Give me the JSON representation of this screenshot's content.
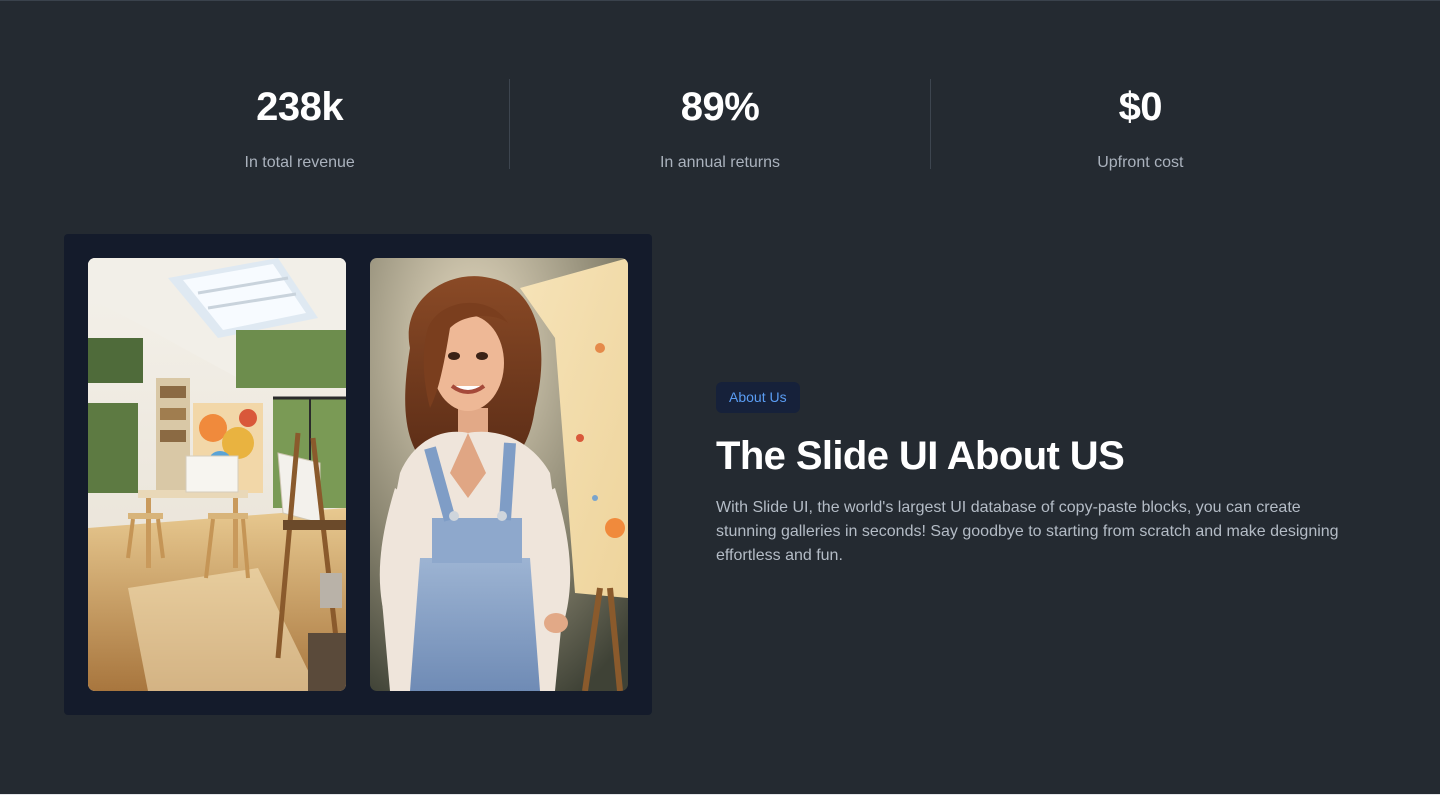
{
  "stats": [
    {
      "value": "238k",
      "label": "In total revenue"
    },
    {
      "value": "89%",
      "label": "In annual returns"
    },
    {
      "value": "$0",
      "label": "Upfront cost"
    }
  ],
  "about": {
    "badge": "About Us",
    "title": "The Slide UI About US",
    "description": "With Slide UI, the world's largest UI database of copy-paste blocks, you can create stunning galleries in seconds! Say goodbye to starting from scratch and make designing effortless and fun."
  },
  "colors": {
    "background": "#242a31",
    "card": "#141b2b",
    "badge_bg": "#16213a",
    "badge_text": "#5a9cf2"
  }
}
